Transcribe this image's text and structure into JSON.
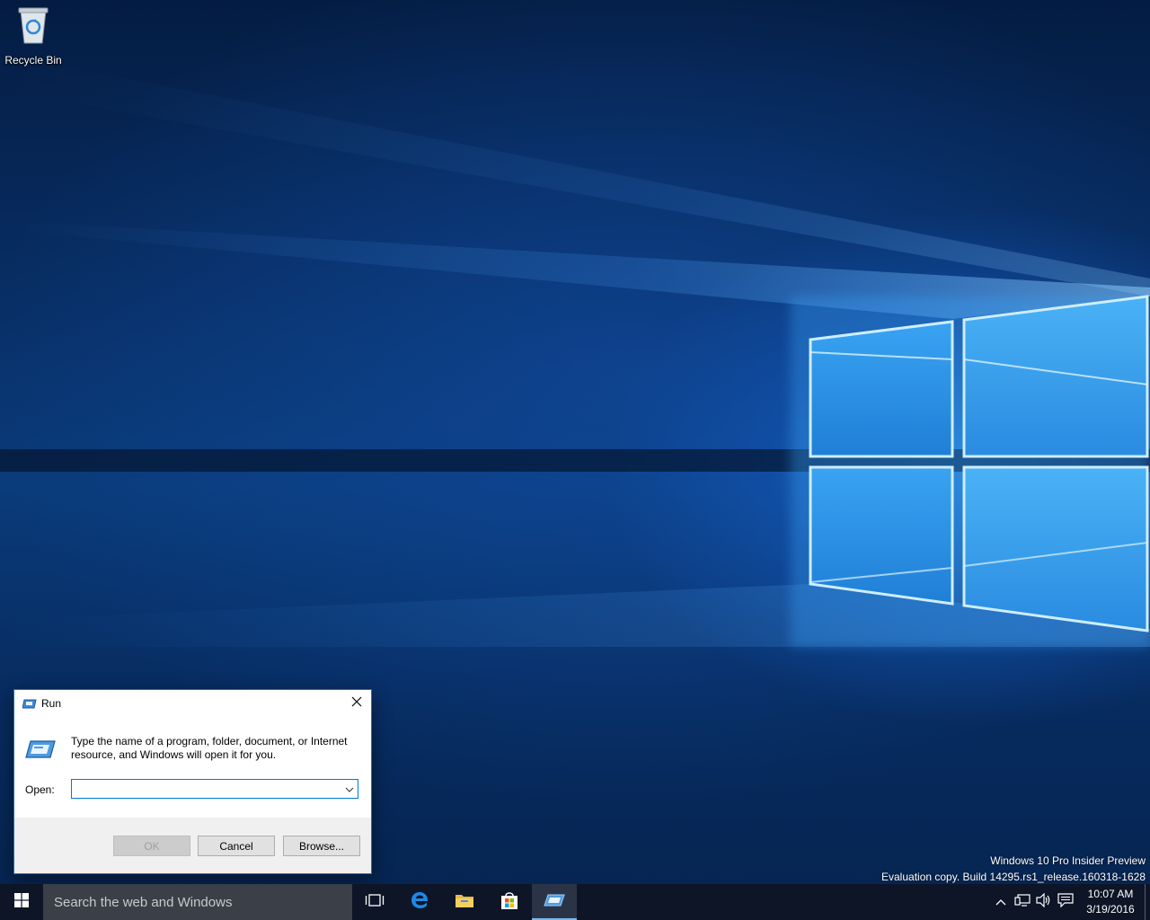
{
  "desktop": {
    "icons": [
      {
        "label": "Recycle Bin",
        "icon": "recycle-bin-icon"
      }
    ],
    "watermark": {
      "line1": "Windows 10 Pro Insider Preview",
      "line2": "Evaluation copy. Build 14295.rs1_release.160318-1628"
    }
  },
  "run_dialog": {
    "title": "Run",
    "close_icon": "close-icon",
    "description": "Type the name of a program, folder, document, or Internet resource, and Windows will open it for you.",
    "open_label": "Open:",
    "open_value": "",
    "buttons": {
      "ok": "OK",
      "cancel": "Cancel",
      "browse": "Browse..."
    },
    "ok_enabled": false
  },
  "taskbar": {
    "search_placeholder": "Search the web and Windows",
    "pinned": [
      "task-view-icon",
      "edge-icon",
      "file-explorer-icon",
      "store-icon",
      "run-icon"
    ],
    "active_app": "run-icon",
    "tray_icons": [
      "chevron-up-icon",
      "network-icon",
      "volume-icon",
      "action-center-icon"
    ],
    "clock": {
      "time": "10:07 AM",
      "date": "3/19/2016"
    }
  },
  "colors": {
    "accent": "#0078d7",
    "taskbar": "#0d1526",
    "search_box": "#3a3f48"
  }
}
